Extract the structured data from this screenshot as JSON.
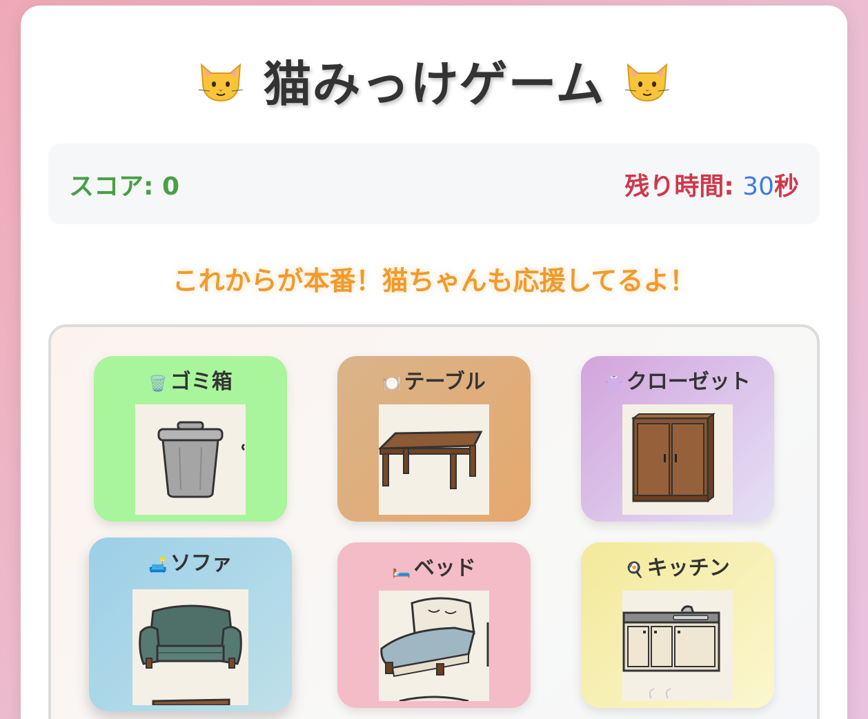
{
  "title": "猫みっけゲーム",
  "score": {
    "label": "スコア: ",
    "value": "0"
  },
  "timer": {
    "label": "残り時間: ",
    "value": "30",
    "unit": "秒"
  },
  "message": "これからが本番！猫ちゃんも応援してるよ！",
  "tiles": [
    {
      "label": "ゴミ箱",
      "emoji": "🗑️",
      "icon": "trash-can-icon"
    },
    {
      "label": "テーブル",
      "emoji": "🍽️",
      "icon": "table-icon"
    },
    {
      "label": "クローゼット",
      "emoji": "👚",
      "icon": "closet-icon"
    },
    {
      "label": "ソファ",
      "emoji": "🛋️",
      "icon": "sofa-icon"
    },
    {
      "label": "ベッド",
      "emoji": "🛏️",
      "icon": "bed-icon"
    },
    {
      "label": "キッチン",
      "emoji": "🍳",
      "icon": "kitchen-icon"
    }
  ],
  "colors": {
    "score": "#48a044",
    "timer_label": "#d0384a",
    "timer_value": "#3a7be0",
    "message": "#ef9b2c",
    "trash_tile": "#a9f59c",
    "table_tile": "#e3ad79",
    "closet_tile": "#d7b2e4",
    "sofa_tile": "#a8d6ea",
    "bed_tile": "#f4bcc6",
    "kitchen_tile": "#f6efaa"
  }
}
